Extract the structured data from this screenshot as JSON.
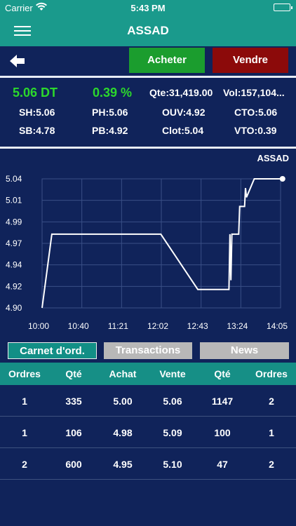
{
  "status_bar": {
    "carrier": "Carrier",
    "time": "5:43 PM"
  },
  "nav": {
    "title": "ASSAD"
  },
  "toolbar": {
    "buy_label": "Acheter",
    "sell_label": "Vendre"
  },
  "quote": {
    "price": "5.06 DT",
    "change": "0.39 %",
    "qte": "Qte:31,419.00",
    "vol": "Vol:157,104...",
    "sh": "SH:5.06",
    "ph": "PH:5.06",
    "ouv": "OUV:4.92",
    "cto": "CTO:5.06",
    "sb": "SB:4.78",
    "pb": "PB:4.92",
    "clot": "Clot:5.04",
    "vto": "VTO:0.39"
  },
  "chart_data": {
    "type": "line",
    "title": "ASSAD",
    "x_ticks": [
      "10:00",
      "10:40",
      "11:21",
      "12:02",
      "12:43",
      "13:24",
      "14:05"
    ],
    "y_ticks": [
      "5.04",
      "5.01",
      "4.99",
      "4.97",
      "4.94",
      "4.92",
      "4.90"
    ],
    "ylim": [
      4.9,
      5.04
    ],
    "grid": true,
    "series": [
      {
        "values": [
          [
            "10:00",
            4.9
          ],
          [
            "10:10",
            4.98
          ],
          [
            "12:02",
            4.98
          ],
          [
            "12:40",
            4.92
          ],
          [
            "13:12",
            4.92
          ],
          [
            "13:13",
            4.98
          ],
          [
            "13:14",
            4.93
          ],
          [
            "13:15",
            4.98
          ],
          [
            "13:22",
            4.98
          ],
          [
            "13:23",
            5.01
          ],
          [
            "13:28",
            5.01
          ],
          [
            "13:29",
            5.03
          ],
          [
            "13:30",
            5.02
          ],
          [
            "13:38",
            5.04
          ],
          [
            "14:07",
            5.04
          ]
        ]
      }
    ],
    "line_color": "#ffffff",
    "grid_color": "#3a4f86"
  },
  "tabs": {
    "carnet": "Carnet d'ord.",
    "transactions": "Transactions",
    "news": "News"
  },
  "order_book": {
    "headers": [
      "Ordres",
      "Qté",
      "Achat",
      "Vente",
      "Qté",
      "Ordres"
    ],
    "rows": [
      [
        "1",
        "335",
        "5.00",
        "5.06",
        "1147",
        "2"
      ],
      [
        "1",
        "106",
        "4.98",
        "5.09",
        "100",
        "1"
      ],
      [
        "2",
        "600",
        "4.95",
        "5.10",
        "47",
        "2"
      ]
    ]
  }
}
